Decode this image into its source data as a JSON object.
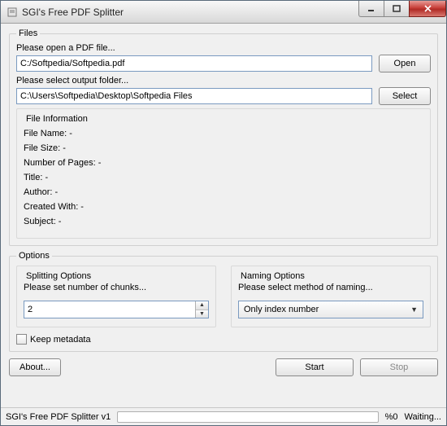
{
  "window": {
    "title": "SGI's Free PDF Splitter"
  },
  "files": {
    "legend": "Files",
    "open_prompt": "Please open a PDF file...",
    "pdf_path": "C:/Softpedia/Softpedia.pdf",
    "open_btn": "Open",
    "output_prompt": "Please select output folder...",
    "output_path": "C:\\Users\\Softpedia\\Desktop\\Softpedia Files",
    "select_btn": "Select",
    "info": {
      "legend": "File Information",
      "file_name": "File Name: -",
      "file_size": "File Size: -",
      "pages": "Number of Pages: -",
      "title": "Title: -",
      "author": "Author: -",
      "created_with": "Created With: -",
      "subject": "Subject: -"
    }
  },
  "options": {
    "legend": "Options",
    "splitting": {
      "legend": "Splitting Options",
      "desc": "Please set number of chunks...",
      "value": "2"
    },
    "naming": {
      "legend": "Naming Options",
      "desc": "Please select method of naming...",
      "value": "Only index number"
    },
    "keep_metadata": "Keep metadata"
  },
  "buttons": {
    "about": "About...",
    "start": "Start",
    "stop": "Stop"
  },
  "status": {
    "app": "SGI's Free PDF Splitter  v1",
    "percent": "%0",
    "state": "Waiting..."
  }
}
